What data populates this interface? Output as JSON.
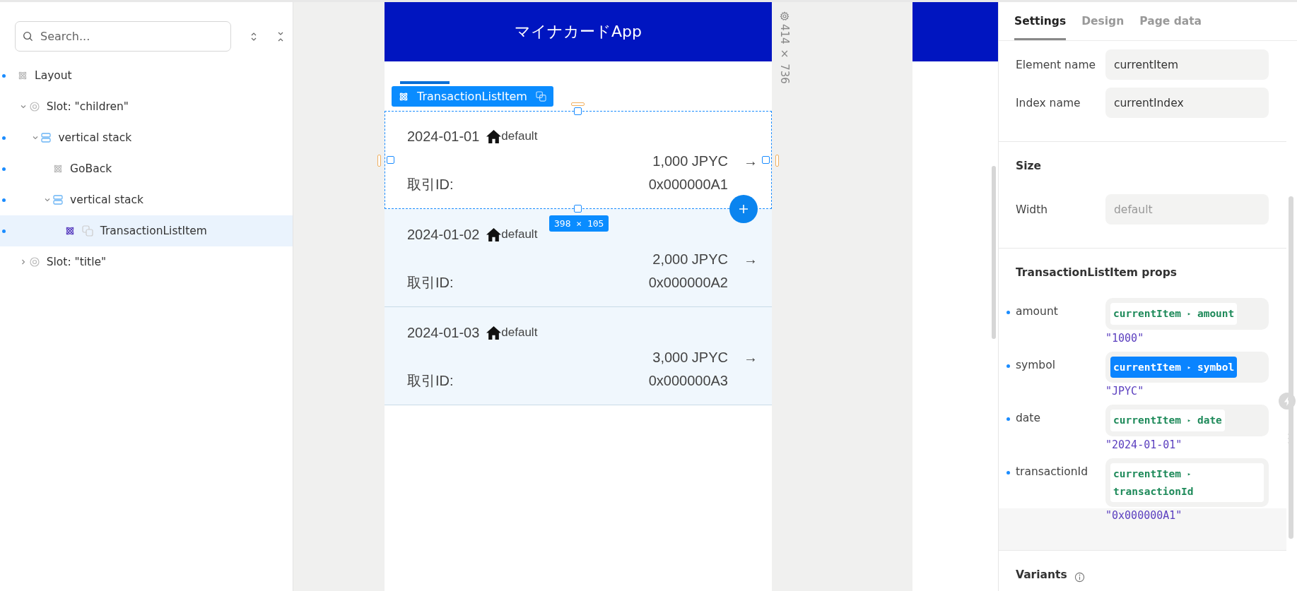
{
  "sidebar": {
    "search": {
      "placeholder": "Search..."
    },
    "tree": [
      {
        "label": "Layout",
        "kind": "component",
        "marked": true,
        "selected": false,
        "children": [
          {
            "label": "Slot: \"children\"",
            "kind": "slot",
            "expanded": true,
            "marked": false,
            "selected": false,
            "children": [
              {
                "label": "vertical stack",
                "kind": "stack",
                "expanded": true,
                "marked": true,
                "selected": false,
                "children": [
                  {
                    "label": "GoBack",
                    "kind": "component",
                    "marked": true,
                    "selected": false
                  },
                  {
                    "label": "vertical stack",
                    "kind": "stack",
                    "expanded": true,
                    "marked": true,
                    "selected": false,
                    "children": [
                      {
                        "label": "TransactionListItem",
                        "kind": "component",
                        "marked": true,
                        "selected": true,
                        "repeated": true
                      }
                    ]
                  }
                ]
              }
            ]
          },
          {
            "label": "Slot: \"title\"",
            "kind": "slot",
            "expanded": false,
            "marked": false,
            "selected": false
          }
        ]
      }
    ]
  },
  "canvas": {
    "size_label": "414 × 736",
    "app": {
      "title": "マイナカードApp",
      "component_tag": "TransactionListItem",
      "size_badge": "398 × 105",
      "items": [
        {
          "date": "2024-01-01",
          "icon_label": "default",
          "amount": "1,000 JPYC",
          "arrow": "→",
          "id_label": "取引ID:",
          "id": "0x000000A1",
          "selected": true
        },
        {
          "date": "2024-01-02",
          "icon_label": "default",
          "amount": "2,000 JPYC",
          "arrow": "→",
          "id_label": "取引ID:",
          "id": "0x000000A2",
          "selected": false
        },
        {
          "date": "2024-01-03",
          "icon_label": "default",
          "amount": "3,000 JPYC",
          "arrow": "→",
          "id_label": "取引ID:",
          "id": "0x000000A3",
          "selected": false
        }
      ]
    }
  },
  "inspector": {
    "tabs": [
      {
        "label": "Settings",
        "selected": true
      },
      {
        "label": "Design",
        "selected": false
      },
      {
        "label": "Page data",
        "selected": false
      }
    ],
    "fields": [
      {
        "label": "Element name",
        "value": "currentItem"
      },
      {
        "label": "Index name",
        "value": "currentIndex"
      }
    ],
    "size": {
      "heading": "Size",
      "width_label": "Width",
      "width_placeholder": "default"
    },
    "props_heading": "TransactionListItem props",
    "props": [
      {
        "name": "amount",
        "object": "currentItem",
        "arrow": "▸",
        "field": "amount",
        "value": "\"1000\"",
        "selected": false
      },
      {
        "name": "symbol",
        "object": "currentItem",
        "arrow": "▸",
        "field": "symbol",
        "value": "\"JPYC\"",
        "selected": true
      },
      {
        "name": "date",
        "object": "currentItem",
        "arrow": "▸",
        "field": "date",
        "value": "\"2024-01-01\"",
        "selected": false
      },
      {
        "name": "transactionId",
        "object": "currentItem",
        "arrow": "▸",
        "field": "transactionId",
        "value": "\"0x000000A1\"",
        "selected": false
      }
    ],
    "variants_heading": "Variants"
  }
}
